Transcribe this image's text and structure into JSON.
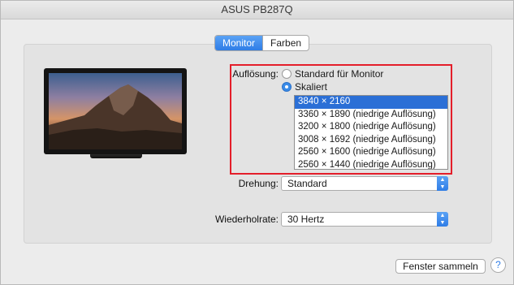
{
  "window": {
    "title": "ASUS PB287Q"
  },
  "tabs": [
    {
      "label": "Monitor",
      "active": true
    },
    {
      "label": "Farben",
      "active": false
    }
  ],
  "resolution": {
    "label": "Auflösung:",
    "options": [
      {
        "label": "Standard für Monitor",
        "checked": false
      },
      {
        "label": "Skaliert",
        "checked": true
      }
    ],
    "list": [
      "3840 × 2160",
      "3360 × 1890 (niedrige Auflösung)",
      "3200 × 1800 (niedrige Auflösung)",
      "3008 × 1692 (niedrige Auflösung)",
      "2560 × 1600 (niedrige Auflösung)",
      "2560 × 1440 (niedrige Auflösung)"
    ],
    "selected_index": 0
  },
  "rotation": {
    "label": "Drehung:",
    "value": "Standard"
  },
  "refresh": {
    "label": "Wiederholrate:",
    "value": "30 Hertz"
  },
  "gather_button": "Fenster sammeln",
  "help_button": "?",
  "colors": {
    "accent": "#2f7de6",
    "highlight_border": "#e41e2a",
    "selection": "#2b6fd6"
  },
  "icons": {
    "popup_arrow": "up-down-chevron-icon",
    "monitor": "monitor-icon"
  }
}
